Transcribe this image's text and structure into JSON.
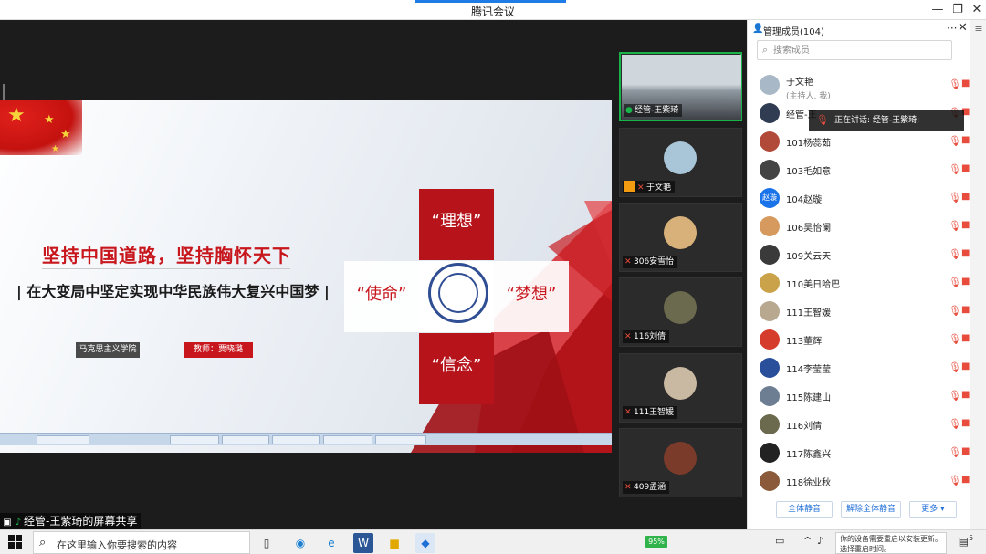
{
  "window": {
    "title": "腾讯会议",
    "accent_color": "#1f7ce6",
    "minimize": "—",
    "maximize": "❐",
    "close": "✕"
  },
  "share_label": "经管-王紫琦的屏幕共享",
  "slide": {
    "title": "坚持中国道路，坚持胸怀天下",
    "subtitle": "| 在大变局中坚定实现中华民族伟大复兴中国梦 |",
    "org_tag": "马克思主义学院",
    "teacher_tag": "教师：贾晓璐",
    "panel_top": "“理想”",
    "panel_left": "“使命”",
    "panel_right": "“梦想”",
    "panel_bottom": "“信念”",
    "brand_red": "#c8161d"
  },
  "video_tiles": [
    {
      "name": "经管-王紫琦",
      "mic": "on",
      "kind": "room"
    },
    {
      "name": "于文艳",
      "mic": "off",
      "kind": "avatar",
      "color": "#a9c6d8",
      "host": true
    },
    {
      "name": "306安雪怡",
      "mic": "off",
      "kind": "avatar",
      "color": "#d8b07a"
    },
    {
      "name": "116刘倩",
      "mic": "off",
      "kind": "avatar",
      "color": "#6b6a4e"
    },
    {
      "name": "111王智媛",
      "mic": "off",
      "kind": "avatar",
      "color": "#c9b9a3"
    },
    {
      "name": "409孟涵",
      "mic": "off",
      "kind": "avatar",
      "color": "#7a3b2a"
    }
  ],
  "members": {
    "title": "管理成员(104)",
    "more": "···",
    "close": "✕",
    "search_placeholder": "搜索成员",
    "speaking_label": "正在讲话: 经管-王紫琦;",
    "list": [
      {
        "name": "于文艳",
        "role": "(主持人, 我)",
        "color": "#a9b8c6"
      },
      {
        "name": "经管-王",
        "role": "",
        "color": "#2f3c52"
      },
      {
        "name": "101杨蕊茹",
        "role": "",
        "color": "#b24a3a"
      },
      {
        "name": "103毛如意",
        "role": "",
        "color": "#444444"
      },
      {
        "name": "104赵璇",
        "role": "",
        "color": "#1a73e8",
        "initials": "赵璇"
      },
      {
        "name": "106吴怡阑",
        "role": "",
        "color": "#d69a5e"
      },
      {
        "name": "109关云天",
        "role": "",
        "color": "#3a3a3a"
      },
      {
        "name": "110美日哈巴",
        "role": "",
        "color": "#c9a24a"
      },
      {
        "name": "111王智媛",
        "role": "",
        "color": "#b8a890"
      },
      {
        "name": "113董辉",
        "role": "",
        "color": "#d63c2c"
      },
      {
        "name": "114李莹莹",
        "role": "",
        "color": "#2a4f9a"
      },
      {
        "name": "115陈建山",
        "role": "",
        "color": "#6e7e92"
      },
      {
        "name": "116刘倩",
        "role": "",
        "color": "#6b6a4e"
      },
      {
        "name": "117陈鑫兴",
        "role": "",
        "color": "#222222"
      },
      {
        "name": "118徐业秋",
        "role": "",
        "color": "#8a5a3a"
      }
    ],
    "buttons": [
      "全体静音",
      "解除全体静音",
      "更多 ▾"
    ]
  },
  "taskbar": {
    "search_text": "在这里输入你要搜索的内容",
    "battery": "95%",
    "notice_line1": "你的设备需要重启以安装更新。",
    "notice_line2": "选择重启时间。",
    "notify_count": "5"
  }
}
